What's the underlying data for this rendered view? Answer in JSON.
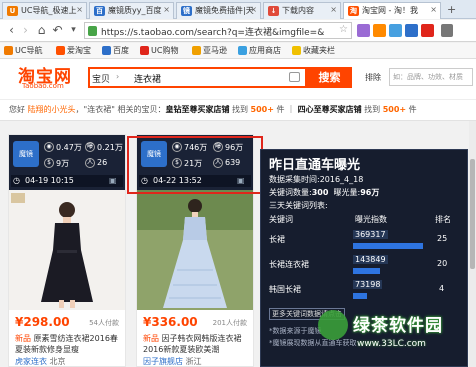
{
  "tabs": [
    {
      "label": "UC导航_极速上",
      "icon": "uc-icon",
      "color": "#f07a00"
    },
    {
      "label": "魔镜质yy_百度",
      "icon": "baidu-icon",
      "color": "#2d6fc9"
    },
    {
      "label": "魔镜免费插件|天",
      "icon": "mojing-icon",
      "color": "#2d6fc9"
    },
    {
      "label": "下载内容",
      "icon": "download-icon",
      "color": "#e04a3a"
    },
    {
      "label": "淘宝网 - 淘！我",
      "icon": "taobao-icon",
      "color": "#ff5000"
    }
  ],
  "address": {
    "url": "https://s.taobao.com/search?q=连衣裙&imgfile=&"
  },
  "bookmarks": [
    {
      "label": "UC导航",
      "color": "#f07a00"
    },
    {
      "label": "爱淘宝",
      "color": "#ff5000"
    },
    {
      "label": "百度",
      "color": "#2d6fc9"
    },
    {
      "label": "UC购物",
      "color": "#e0261b"
    },
    {
      "label": "亚马逊",
      "color": "#f0a000"
    },
    {
      "label": "应用商店",
      "color": "#3aa0e0"
    },
    {
      "label": "收藏夹栏",
      "color": "#f0c000"
    }
  ],
  "header": {
    "logo": "淘宝网",
    "logo_sub": "Taobao.com",
    "scope": "宝贝",
    "query": "连衣裙",
    "search_label": "搜索",
    "sort_label": "排除",
    "sort_placeholder": "如：品牌、功效、材质"
  },
  "notice": {
    "prefix": "您好 ",
    "user": "陆翔的小光头",
    "mid": "，\"连衣裙\" 相关的宝贝：",
    "crown_label": "皇钻至尊买家店铺",
    "found1": " 找到 ",
    "count1": "500+",
    "sep": " 件 ｜ ",
    "crown2_label": "四心至尊买家店铺",
    "found2": " 找到 ",
    "count2": "500+",
    "suffix": " 件"
  },
  "cards": [
    {
      "qbox": "魔镜",
      "m1": "0.47万",
      "m2": "0.21万",
      "m3": "9万",
      "m4": "26",
      "date": "04-19 10:15",
      "price": "¥298.00",
      "sold": "54人付款",
      "desc_hl": "新品",
      "desc": "原素雪纺连衣裙2016春夏装新款修身显瘦",
      "loc_shop": "虎家连衣",
      "loc_city": "北京"
    },
    {
      "qbox": "魔镜",
      "m1": "746万",
      "m2": "96万",
      "m3": "21万",
      "m4": "639",
      "date": "04-22 13:52",
      "price": "¥336.00",
      "sold": "201人付款",
      "desc_hl": "新品",
      "desc": "因子韩衣网韩版连衣裙2016新款夏装欧美潮",
      "loc_shop": "因子旗舰店",
      "loc_city": "浙江"
    }
  ],
  "popup": {
    "title": "昨日直通车曝光",
    "line1": "数据采集时间:2016_4_18",
    "line2_label": "关键词数量:",
    "line2_val": "300",
    "line2b_label": "曝光量:",
    "line2b_val": "96万",
    "line3": "三天关键词列表:",
    "headers": [
      "关键词",
      "曝光指数",
      "排名"
    ],
    "rows": [
      {
        "kw": "长裙",
        "val": "369317",
        "rank": "25",
        "frac": 1.0
      },
      {
        "kw": "长裙连衣裙",
        "val": "143849",
        "rank": "20",
        "frac": 0.39
      },
      {
        "kw": "韩国长裙",
        "val": "73198",
        "rank": "4",
        "frac": 0.2
      }
    ],
    "more_label": "更多关键词数据请点击",
    "fine1": "*数据来源于魔镜",
    "fine2": "*魔镜展现数据从直通车获取"
  },
  "watermark": {
    "text": "绿茶软件园",
    "url": "www.33LC.com"
  },
  "colors": {
    "accent": "#ff4400",
    "highlight_box": "#e0261b",
    "popup_bg": "#161d2e",
    "bar": "#2e74e0"
  }
}
